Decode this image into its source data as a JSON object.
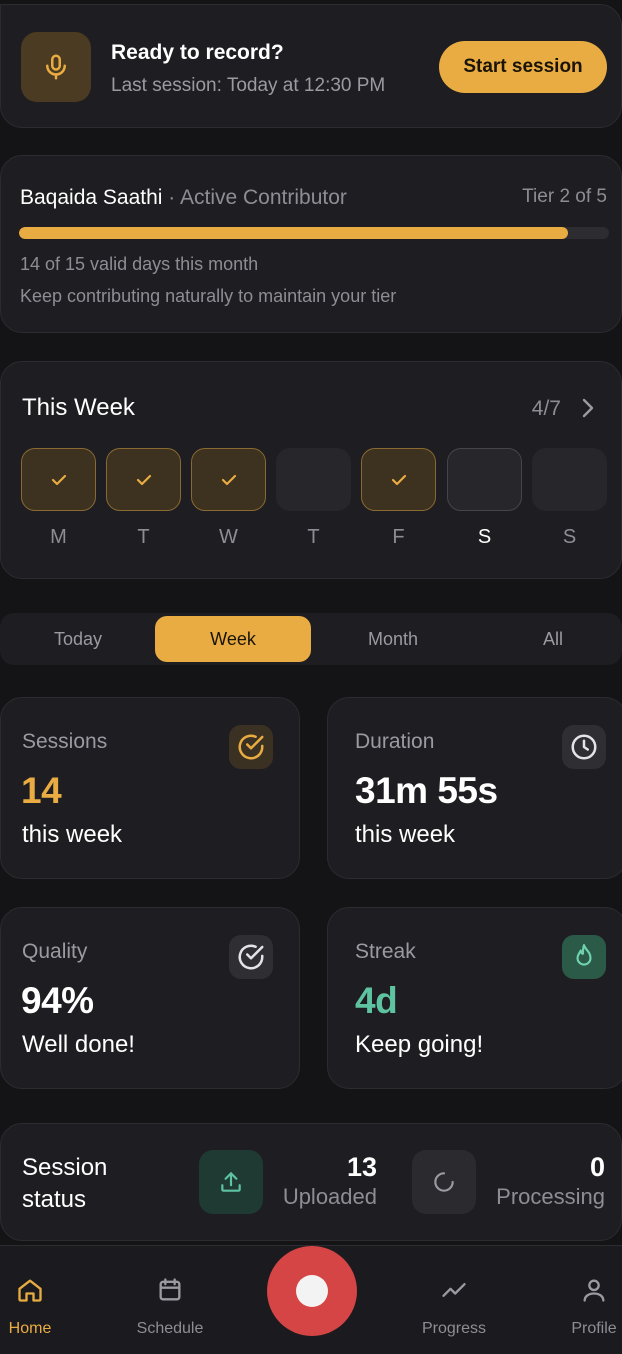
{
  "colors": {
    "accent": "#e9ac42",
    "success": "#5ec3a0",
    "record": "#d64545",
    "background": "#141417",
    "card": "#1e1e22"
  },
  "record": {
    "icon": "microphone-icon",
    "title": "Ready to record?",
    "subtitle": "Last session: Today at 12:30 PM",
    "button": "Start session"
  },
  "tier": {
    "name": "Baqaida Saathi",
    "separator": "·",
    "role": "Active Contributor",
    "tier_text": "Tier 2 of 5",
    "progress_fraction": 0.93,
    "days_text": "14 of 15 valid days this month",
    "hint": "Keep contributing naturally to maintain your tier"
  },
  "week": {
    "title": "This Week",
    "count": "4/7",
    "days": [
      {
        "label": "M",
        "status": "done"
      },
      {
        "label": "T",
        "status": "done"
      },
      {
        "label": "W",
        "status": "done"
      },
      {
        "label": "T",
        "status": "empty"
      },
      {
        "label": "F",
        "status": "done"
      },
      {
        "label": "S",
        "status": "today"
      },
      {
        "label": "S",
        "status": "empty"
      }
    ]
  },
  "tabs": {
    "items": [
      "Today",
      "Week",
      "Month",
      "All"
    ],
    "active": "Week"
  },
  "stats": {
    "sessions": {
      "label": "Sessions",
      "value": "14",
      "sub": "this week",
      "icon": "check-circle-icon"
    },
    "duration": {
      "label": "Duration",
      "value": "31m 55s",
      "sub": "this week",
      "icon": "clock-icon"
    },
    "quality": {
      "label": "Quality",
      "value": "94%",
      "sub": "Well done!",
      "icon": "check-circle-icon"
    },
    "streak": {
      "label": "Streak",
      "value": "4d",
      "sub": "Keep going!",
      "icon": "flame-icon"
    }
  },
  "session_status": {
    "title": "Session status",
    "uploaded": {
      "value": "13",
      "label": "Uploaded",
      "icon": "upload-icon"
    },
    "processing": {
      "value": "0",
      "label": "Processing",
      "icon": "spinner-icon"
    }
  },
  "nav": {
    "home": "Home",
    "schedule": "Schedule",
    "progress": "Progress",
    "profile": "Profile"
  }
}
